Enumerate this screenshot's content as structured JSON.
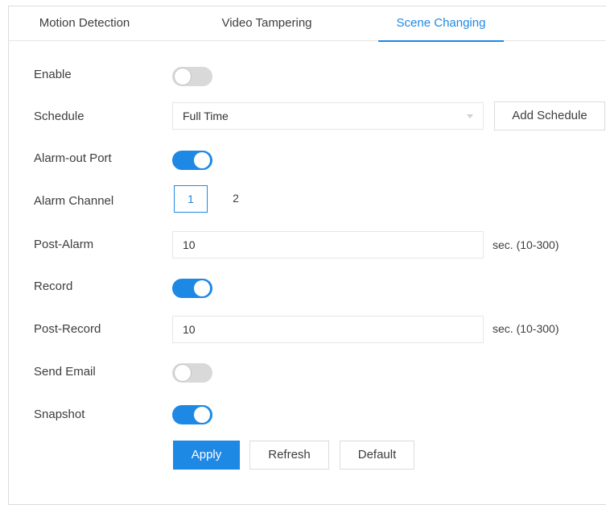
{
  "tabs": [
    {
      "label": "Motion Detection",
      "active": false
    },
    {
      "label": "Video Tampering",
      "active": false
    },
    {
      "label": "Scene Changing",
      "active": true
    }
  ],
  "form": {
    "enable": {
      "label": "Enable",
      "on": false
    },
    "schedule": {
      "label": "Schedule",
      "value": "Full Time",
      "add_button": "Add Schedule"
    },
    "alarm_out_port": {
      "label": "Alarm-out Port",
      "on": true
    },
    "alarm_channel": {
      "label": "Alarm Channel",
      "options": [
        "1",
        "2"
      ],
      "selected": "1"
    },
    "post_alarm": {
      "label": "Post-Alarm",
      "value": "10",
      "unit": "sec. (10-300)"
    },
    "record": {
      "label": "Record",
      "on": true
    },
    "post_record": {
      "label": "Post-Record",
      "value": "10",
      "unit": "sec. (10-300)"
    },
    "send_email": {
      "label": "Send Email",
      "on": false
    },
    "snapshot": {
      "label": "Snapshot",
      "on": true
    }
  },
  "buttons": {
    "apply": "Apply",
    "refresh": "Refresh",
    "default": "Default"
  },
  "colors": {
    "accent": "#1e88e5",
    "toggle_off": "#d9d9d9",
    "border": "#e6e6e6",
    "text": "#3d3d3d"
  }
}
